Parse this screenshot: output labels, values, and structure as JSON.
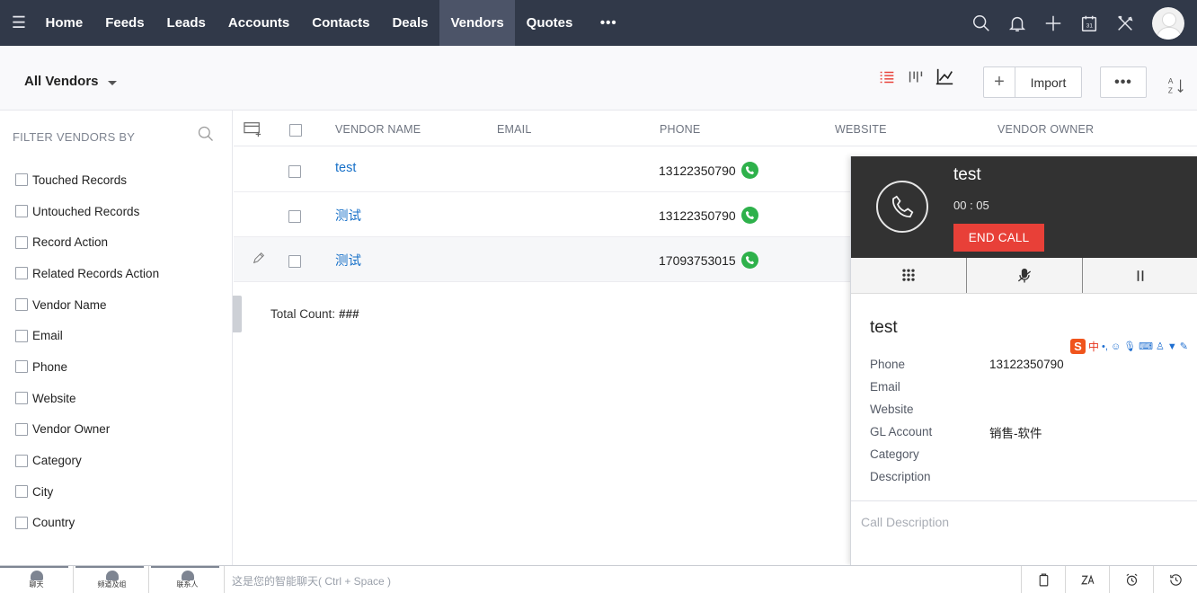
{
  "nav": {
    "tabs": [
      {
        "label": "Home",
        "active": false
      },
      {
        "label": "Feeds",
        "active": false
      },
      {
        "label": "Leads",
        "active": false
      },
      {
        "label": "Accounts",
        "active": false
      },
      {
        "label": "Contacts",
        "active": false
      },
      {
        "label": "Deals",
        "active": false
      },
      {
        "label": "Vendors",
        "active": true
      },
      {
        "label": "Quotes",
        "active": false
      }
    ],
    "more_label": "•••",
    "right_icons": [
      "search-icon",
      "bell-icon",
      "plus-icon",
      "calendar-icon",
      "tools-icon",
      "avatar"
    ]
  },
  "header": {
    "view_label": "All Vendors",
    "import_label": "Import",
    "more_label": "•••"
  },
  "sidebar": {
    "title": "FILTER VENDORS BY",
    "filters": [
      "Touched Records",
      "Untouched Records",
      "Record Action",
      "Related Records Action",
      "Vendor Name",
      "Email",
      "Phone",
      "Website",
      "Vendor Owner",
      "Category",
      "City",
      "Country"
    ]
  },
  "table": {
    "columns": [
      "VENDOR NAME",
      "EMAIL",
      "PHONE",
      "WEBSITE",
      "VENDOR OWNER"
    ],
    "rows": [
      {
        "name": "test",
        "phone": "13122350790"
      },
      {
        "name": "测试",
        "phone": "13122350790"
      },
      {
        "name": "测试",
        "phone": "17093753015"
      }
    ],
    "total_label": "Total Count:",
    "total_value": "###"
  },
  "call_panel": {
    "caller": "test",
    "timer": "00 : 05",
    "end_label": "END CALL",
    "record_name": "test",
    "fields": [
      {
        "label": "Phone",
        "value": "13122350790"
      },
      {
        "label": "Email",
        "value": ""
      },
      {
        "label": "Website",
        "value": ""
      },
      {
        "label": "GL Account",
        "value": "销售-软件"
      },
      {
        "label": "Category",
        "value": ""
      },
      {
        "label": "Description",
        "value": ""
      }
    ],
    "description_placeholder": "Call Description",
    "ime": {
      "logo": "S",
      "lang": "中"
    }
  },
  "bottombar": {
    "tabs": [
      "聊天",
      "频道及组",
      "联系人"
    ],
    "chat_placeholder": "这是您的智能聊天( Ctrl + Space )"
  },
  "colors": {
    "nav_bg": "#313949",
    "nav_active": "#4c5468",
    "link": "#1770c8",
    "call_green": "#2eb14b",
    "end_call_red": "#e84038"
  }
}
